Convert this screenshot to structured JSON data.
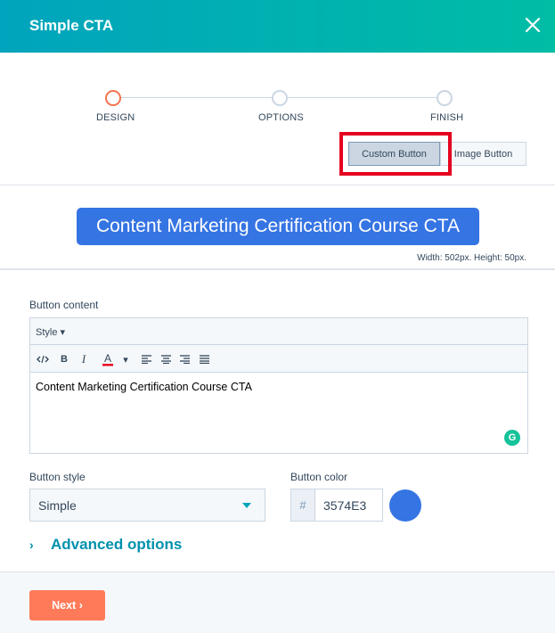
{
  "modal": {
    "title": "Simple CTA"
  },
  "steps": [
    {
      "label": "DESIGN",
      "state": "active"
    },
    {
      "label": "OPTIONS",
      "state": "pending"
    },
    {
      "label": "FINISH",
      "state": "pending"
    }
  ],
  "button_type": {
    "custom_label": "Custom Button",
    "image_label": "Image Button",
    "selected": "Custom Button"
  },
  "preview": {
    "cta_text": "Content Marketing Certification Course CTA",
    "dimensions": "Width: 502px. Height: 50px."
  },
  "editor": {
    "label": "Button content",
    "style_menu": "Style",
    "tools": [
      "source-code-icon",
      "bold-icon",
      "italic-icon",
      "text-color-icon",
      "align-left-icon",
      "align-center-icon",
      "align-right-icon",
      "align-justify-icon"
    ],
    "content": "Content Marketing Certification Course CTA",
    "grammarly_letter": "G"
  },
  "button_style": {
    "label": "Button style",
    "value": "Simple"
  },
  "button_color": {
    "label": "Button color",
    "hash": "#",
    "value": "3574E3",
    "swatch": "#3574e3"
  },
  "advanced": {
    "label": "Advanced options"
  },
  "footer": {
    "next_label": "Next ›"
  },
  "colors": {
    "accent": "#00a4bd",
    "active_step": "#f2734f",
    "cta": "#3574e3",
    "next": "#ff7a59",
    "highlight": "#e5001f"
  }
}
